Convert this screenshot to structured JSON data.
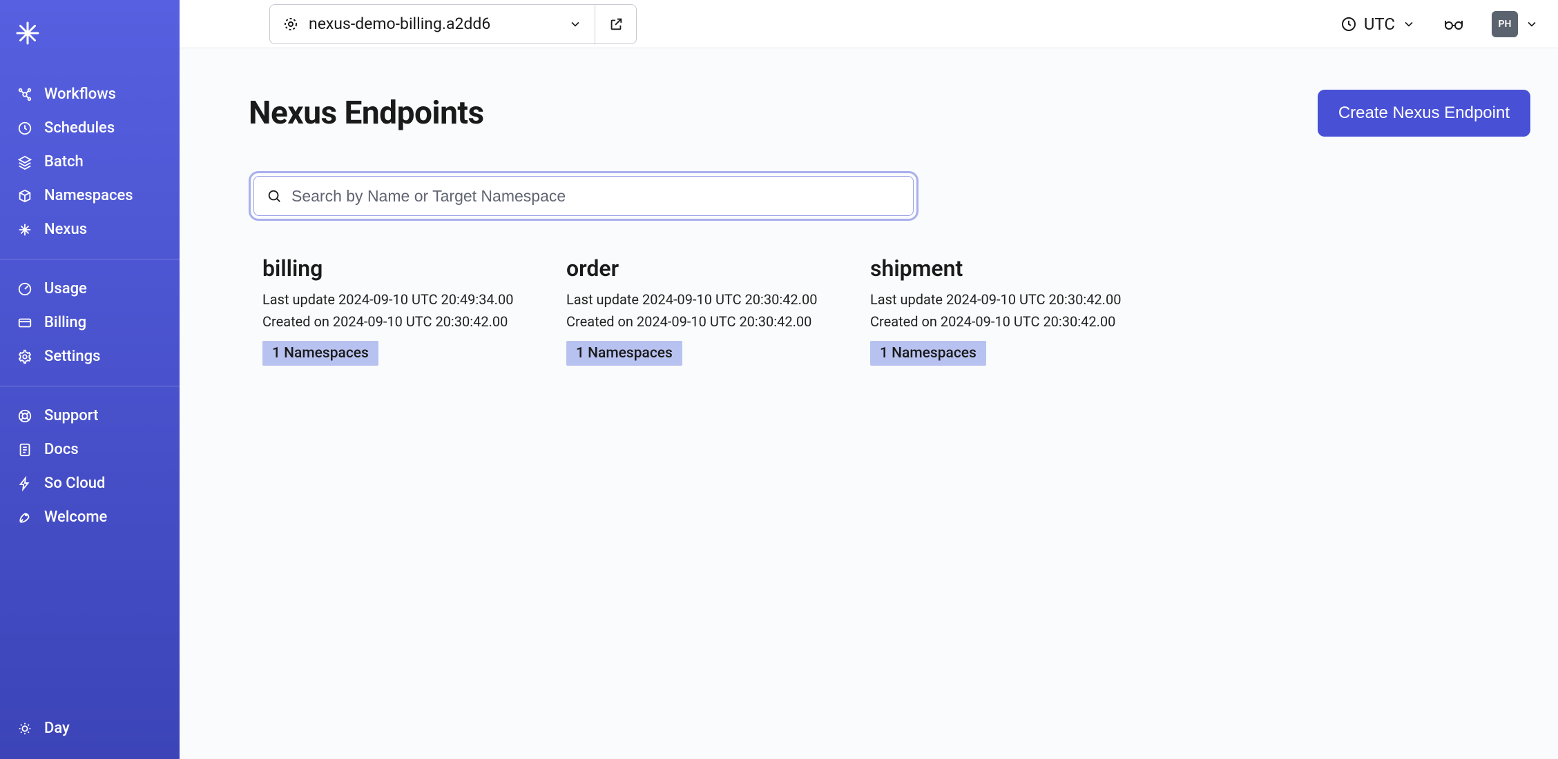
{
  "sidebar": {
    "groups": [
      {
        "items": [
          {
            "icon": "workflows",
            "label": "Workflows"
          },
          {
            "icon": "schedules",
            "label": "Schedules"
          },
          {
            "icon": "batch",
            "label": "Batch"
          },
          {
            "icon": "namespaces",
            "label": "Namespaces"
          },
          {
            "icon": "nexus",
            "label": "Nexus"
          }
        ]
      },
      {
        "items": [
          {
            "icon": "usage",
            "label": "Usage"
          },
          {
            "icon": "billing",
            "label": "Billing"
          },
          {
            "icon": "settings",
            "label": "Settings"
          }
        ]
      },
      {
        "items": [
          {
            "icon": "support",
            "label": "Support"
          },
          {
            "icon": "docs",
            "label": "Docs"
          },
          {
            "icon": "cloud",
            "label": "So Cloud"
          },
          {
            "icon": "welcome",
            "label": "Welcome"
          }
        ]
      }
    ],
    "bottom": {
      "icon": "day",
      "label": "Day"
    }
  },
  "topbar": {
    "namespace": "nexus-demo-billing.a2dd6",
    "timezone": "UTC",
    "avatar": "PH"
  },
  "page": {
    "title": "Nexus Endpoints",
    "create_label": "Create Nexus Endpoint",
    "search_placeholder": "Search by Name or Target Namespace"
  },
  "endpoints": [
    {
      "name": "billing",
      "updated": "Last update 2024-09-10 UTC 20:49:34.00",
      "created": "Created on 2024-09-10 UTC 20:30:42.00",
      "badge": "1 Namespaces"
    },
    {
      "name": "order",
      "updated": "Last update 2024-09-10 UTC 20:30:42.00",
      "created": "Created on 2024-09-10 UTC 20:30:42.00",
      "badge": "1 Namespaces"
    },
    {
      "name": "shipment",
      "updated": "Last update 2024-09-10 UTC 20:30:42.00",
      "created": "Created on 2024-09-10 UTC 20:30:42.00",
      "badge": "1 Namespaces"
    }
  ]
}
